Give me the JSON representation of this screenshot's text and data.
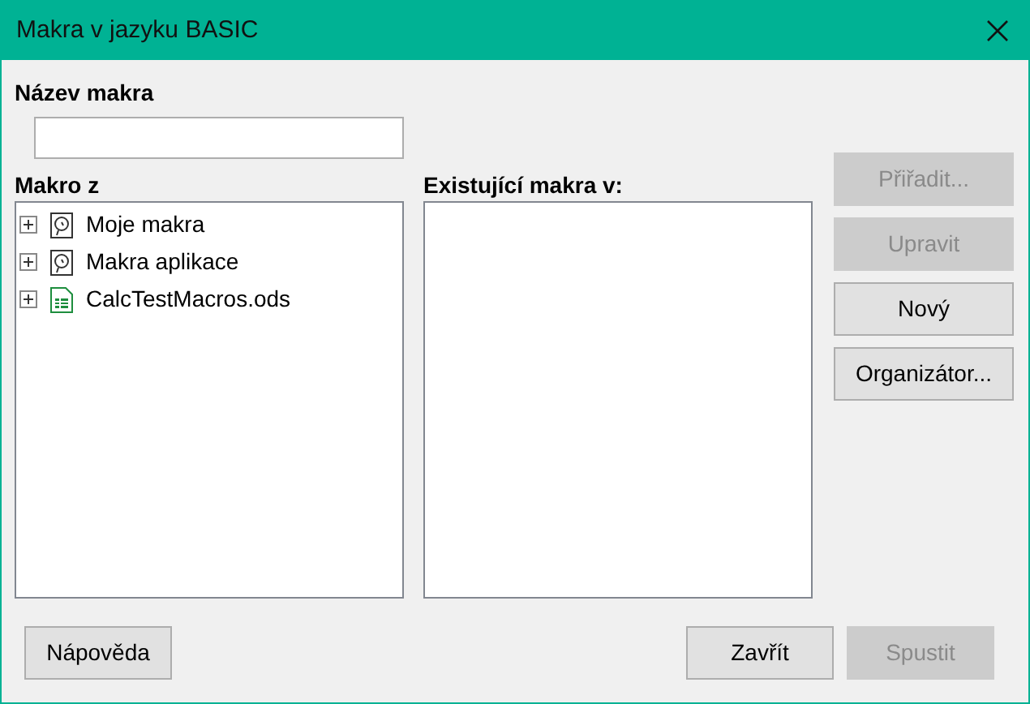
{
  "window": {
    "title": "Makra v jazyku BASIC"
  },
  "macro_name": {
    "label": "Název makra"
  },
  "macro_from": {
    "label": "Makro z",
    "items": [
      {
        "label": "Moje makra",
        "kind": "library",
        "expanded": false
      },
      {
        "label": "Makra aplikace",
        "kind": "library",
        "expanded": false
      },
      {
        "label": "CalcTestMacros.ods",
        "kind": "spreadsheet",
        "expanded": false
      }
    ]
  },
  "existing_macros": {
    "label": "Existující makra v:"
  },
  "side_buttons": [
    {
      "label": "Přiřadit...",
      "disabled": true
    },
    {
      "label": "Upravit",
      "disabled": true
    },
    {
      "label": "Nový",
      "disabled": false
    },
    {
      "label": "Organizátor...",
      "disabled": false
    }
  ],
  "footer": {
    "help": {
      "label": "Nápověda",
      "disabled": false
    },
    "buttons": [
      {
        "label": "Zavřít",
        "disabled": false
      },
      {
        "label": "Spustit",
        "disabled": true
      }
    ]
  }
}
